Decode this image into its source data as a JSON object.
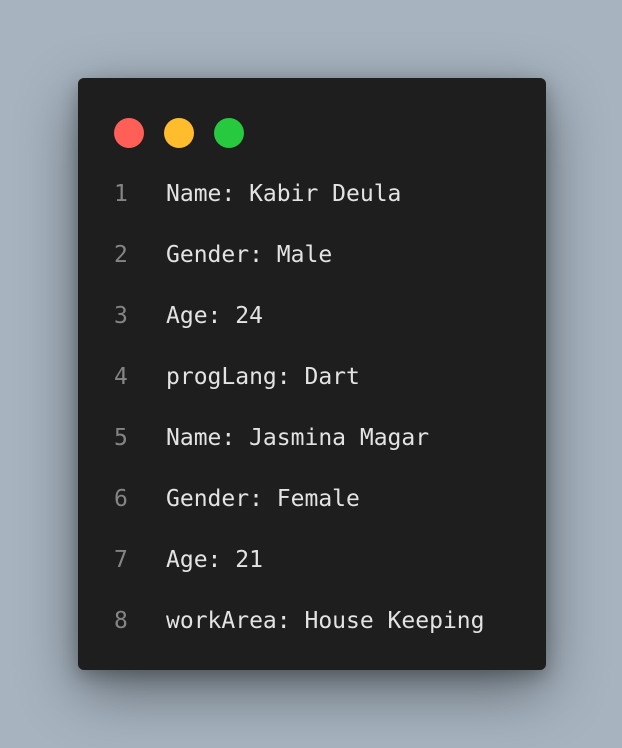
{
  "window": {
    "background": "#1e1e1e",
    "page_background": "#a7b4c0",
    "controls": [
      {
        "name": "close",
        "color": "#ff5f56"
      },
      {
        "name": "minimize",
        "color": "#ffbd2e"
      },
      {
        "name": "maximize",
        "color": "#27c93f"
      }
    ]
  },
  "code": {
    "lines": [
      {
        "number": "1",
        "text": "Name: Kabir Deula"
      },
      {
        "number": "2",
        "text": "Gender: Male"
      },
      {
        "number": "3",
        "text": "Age: 24"
      },
      {
        "number": "4",
        "text": "progLang: Dart"
      },
      {
        "number": "5",
        "text": "Name: Jasmina Magar"
      },
      {
        "number": "6",
        "text": "Gender: Female"
      },
      {
        "number": "7",
        "text": "Age: 21"
      },
      {
        "number": "8",
        "text": "workArea: House Keeping"
      }
    ]
  }
}
